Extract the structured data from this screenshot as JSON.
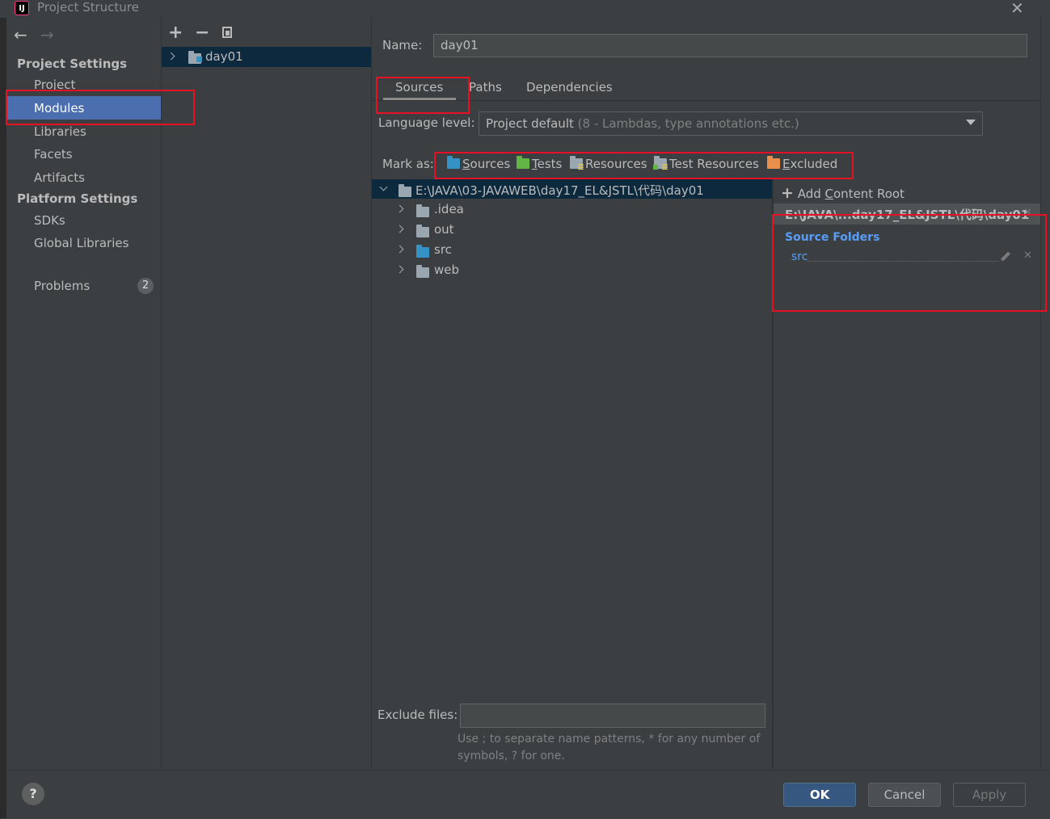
{
  "window": {
    "title": "Project Structure",
    "app_icon": "IJ",
    "close_glyph": "✕"
  },
  "toolbar": {
    "back": "←",
    "forward": "→",
    "add": "+",
    "remove": "−"
  },
  "sidebar": {
    "project_settings": "Project Settings",
    "items_project": [
      "Project",
      "Modules",
      "Libraries",
      "Facets",
      "Artifacts"
    ],
    "platform_settings": "Platform Settings",
    "items_platform": [
      "SDKs",
      "Global Libraries"
    ],
    "problems": "Problems",
    "problems_count": "2"
  },
  "modules": {
    "items": [
      "day01"
    ]
  },
  "main": {
    "name_label": "Name:",
    "name_value": "day01",
    "tabs": [
      "Sources",
      "Paths",
      "Dependencies"
    ],
    "language_label": "Language level:",
    "language_value": "Project default",
    "language_hint": "(8 - Lambdas, type annotations etc.)",
    "mark_as_label": "Mark as:",
    "mark_as": [
      {
        "label_first": "S",
        "label_rest": "ources",
        "color": "#3592c4"
      },
      {
        "label_first": "T",
        "label_rest": "ests",
        "color": "#62b543"
      },
      {
        "label_first": "",
        "label_rest": "Resources",
        "color": "#9aa7b0"
      },
      {
        "label_first": "",
        "label_rest": "Test Resources",
        "color": "#9aa7b0"
      },
      {
        "label_first": "E",
        "label_rest": "xcluded",
        "color": "#e88f4b"
      }
    ],
    "tree_root": "E:\\JAVA\\03-JAVAWEB\\day17_EL&JSTL\\代码\\day01",
    "tree_children": [
      ".idea",
      "out",
      "src",
      "web"
    ],
    "exclude_label": "Exclude files:",
    "exclude_hint_1": "Use ; to separate name patterns, * for any number of",
    "exclude_hint_2": "symbols, ? for one."
  },
  "right": {
    "add_root_prefix": "Add ",
    "add_root_u": "C",
    "add_root_rest": "ontent Root",
    "root_path": "E:\\JAVA\\...day17_EL&JSTL\\代码\\day01",
    "source_folders_title": "Source Folders",
    "source_folders": [
      "src"
    ]
  },
  "buttons": {
    "help": "?",
    "ok": "OK",
    "cancel": "Cancel",
    "apply": "Apply"
  },
  "colors": {
    "selection": "#4b6eaf",
    "tree_selection": "#0d293e",
    "source_folder": "#589df6",
    "highlight_box": "#e81123"
  }
}
